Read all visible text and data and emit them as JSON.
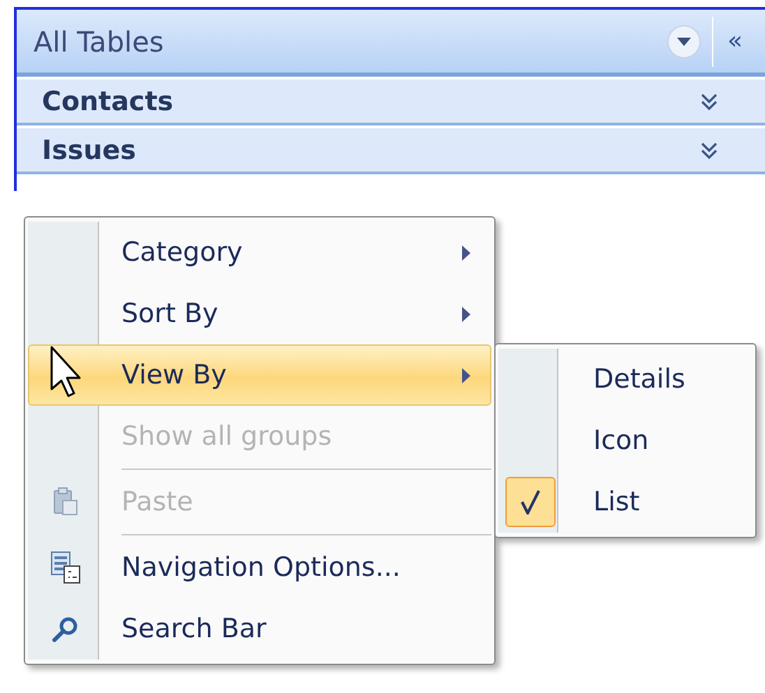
{
  "pane": {
    "title": "All Tables",
    "collapse_glyph": "«",
    "groups": [
      {
        "label": "Contacts",
        "expanded": false
      },
      {
        "label": "Issues",
        "expanded": false
      }
    ]
  },
  "context_menu": {
    "items": [
      {
        "kind": "item",
        "label": "Category",
        "has_submenu": true,
        "disabled": false,
        "selected": false
      },
      {
        "kind": "item",
        "label": "Sort By",
        "has_submenu": true,
        "disabled": false,
        "selected": false
      },
      {
        "kind": "item",
        "label": "View By",
        "has_submenu": true,
        "disabled": false,
        "selected": true
      },
      {
        "kind": "item",
        "label": "Show all groups",
        "has_submenu": false,
        "disabled": true,
        "selected": false
      },
      {
        "kind": "separator"
      },
      {
        "kind": "item",
        "label": "Paste",
        "has_submenu": false,
        "disabled": true,
        "selected": false
      },
      {
        "kind": "separator"
      },
      {
        "kind": "item",
        "label": "Navigation Options...",
        "has_submenu": false,
        "disabled": false,
        "selected": false
      },
      {
        "kind": "item",
        "label": "Search Bar",
        "has_submenu": false,
        "disabled": false,
        "selected": false
      }
    ]
  },
  "submenu": {
    "items": [
      {
        "label": "Details",
        "checked": false
      },
      {
        "label": "Icon",
        "checked": false
      },
      {
        "label": "List",
        "checked": true
      }
    ]
  }
}
